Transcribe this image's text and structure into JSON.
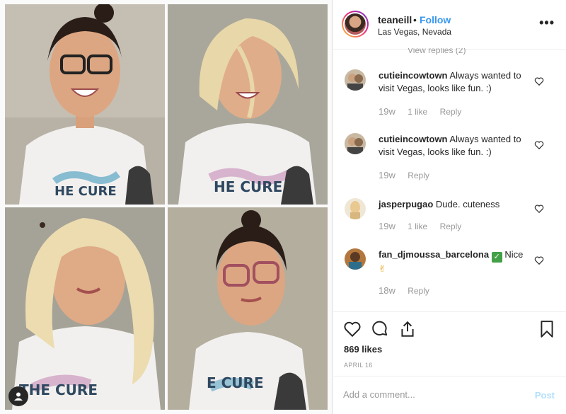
{
  "header": {
    "username": "teaneill",
    "separator": "•",
    "follow_label": "Follow",
    "location": "Las Vegas, Nevada",
    "more_label": "•••"
  },
  "view_replies": "View replies (2)",
  "comments": [
    {
      "username": "cutieincowtown",
      "text": "Always wanted to visit Vegas, looks like fun. :)",
      "time": "19w",
      "likes": "1 like",
      "reply": "Reply"
    },
    {
      "username": "cutieincowtown",
      "text": "Always wanted to visit Vegas, looks like fun. :)",
      "time": "19w",
      "reply": "Reply"
    },
    {
      "username": "jasperpugao",
      "text": "Dude. cuteness",
      "time": "19w",
      "likes": "1 like",
      "reply": "Reply"
    },
    {
      "username": "fan_djmoussa_barcelona",
      "text": "Nice",
      "emoji": "✌",
      "time": "18w",
      "reply": "Reply"
    }
  ],
  "post": {
    "likes": "869 likes",
    "date": "APRIL 16"
  },
  "add_comment": {
    "placeholder": "Add a comment...",
    "post_label": "Post"
  },
  "colors": {
    "link_blue": "#3897f0",
    "post_disabled": "#b2dffc",
    "muted": "#999999",
    "text": "#262626"
  },
  "icons": [
    "heart-icon",
    "comment-icon",
    "share-icon",
    "bookmark-icon",
    "more-icon",
    "user-tag-icon"
  ]
}
